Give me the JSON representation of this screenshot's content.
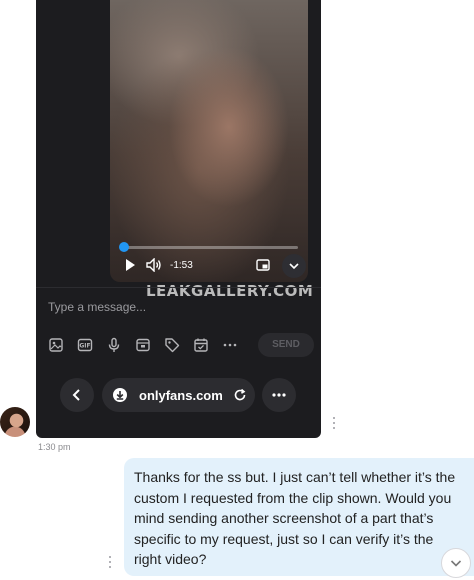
{
  "attachment": {
    "video": {
      "time_remaining": "-1:53",
      "progress": 0.02
    },
    "watermark": "LEAKGALLERY.COM",
    "composer": {
      "placeholder": "Type a message...",
      "send_label": "SEND",
      "toolbar_icons": [
        "image-icon",
        "gif-icon",
        "microphone-icon",
        "vault-icon",
        "tag-icon",
        "calendar-icon",
        "more-icon"
      ]
    },
    "browser": {
      "url": "onlyfans.com"
    }
  },
  "chat": {
    "timestamp": "1:30 pm",
    "outgoing_message": "Thanks for the ss but. I just can’t tell whether it’s the custom I requested from the clip shown. Would you mind sending another screenshot of a part that’s specific to my request, just so I can verify it’s the right video?",
    "bubble_color": "#e3f1fb"
  },
  "colors": {
    "accent": "#2196f3",
    "dark_panel": "#1c1c1f"
  }
}
